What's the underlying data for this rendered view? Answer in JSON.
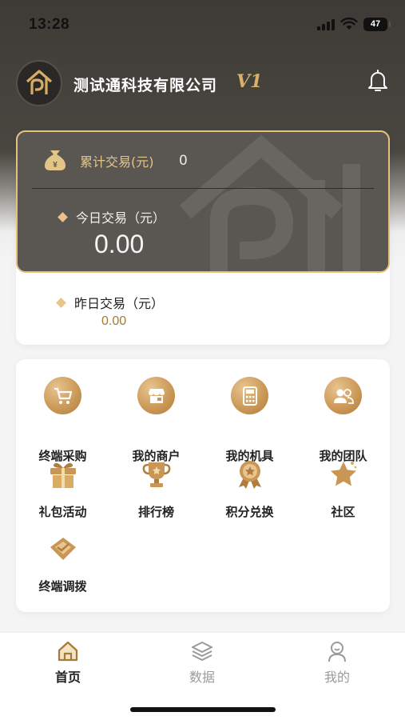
{
  "status_bar": {
    "time": "13:28",
    "battery": "47"
  },
  "header": {
    "company_name": "测试通科技有限公司",
    "vip_level": "V1",
    "icons": {
      "avatar": "logo-icon",
      "bell": "bell-icon"
    }
  },
  "summary": {
    "cumulative_label": "累计交易(元)",
    "cumulative_value": "0",
    "today_label": "今日交易（元）",
    "today_value": "0.00",
    "yesterday_label": "昨日交易（元）",
    "yesterday_value": "0.00"
  },
  "menu": {
    "items": [
      {
        "label": "终端采购",
        "icon": "cart-icon"
      },
      {
        "label": "我的商户",
        "icon": "shop-icon"
      },
      {
        "label": "我的机具",
        "icon": "pos-terminal-icon"
      },
      {
        "label": "我的团队",
        "icon": "team-icon"
      },
      {
        "label": "礼包活动",
        "icon": "gift-icon"
      },
      {
        "label": "排行榜",
        "icon": "trophy-icon"
      },
      {
        "label": "积分兑换",
        "icon": "medal-icon"
      },
      {
        "label": "社区",
        "icon": "star-icon"
      },
      {
        "label": "终端调拨",
        "icon": "diamond-icon"
      }
    ]
  },
  "tab_bar": {
    "tabs": [
      {
        "label": "首页",
        "icon": "home-icon",
        "active": true
      },
      {
        "label": "数据",
        "icon": "layers-icon",
        "active": false
      },
      {
        "label": "我的",
        "icon": "user-icon",
        "active": false
      }
    ]
  },
  "colors": {
    "accent_gold": "#c99655",
    "dark_panel": "#5a5753",
    "active_tab": "#a57a35",
    "inactive_tab": "#9a9a9a"
  }
}
